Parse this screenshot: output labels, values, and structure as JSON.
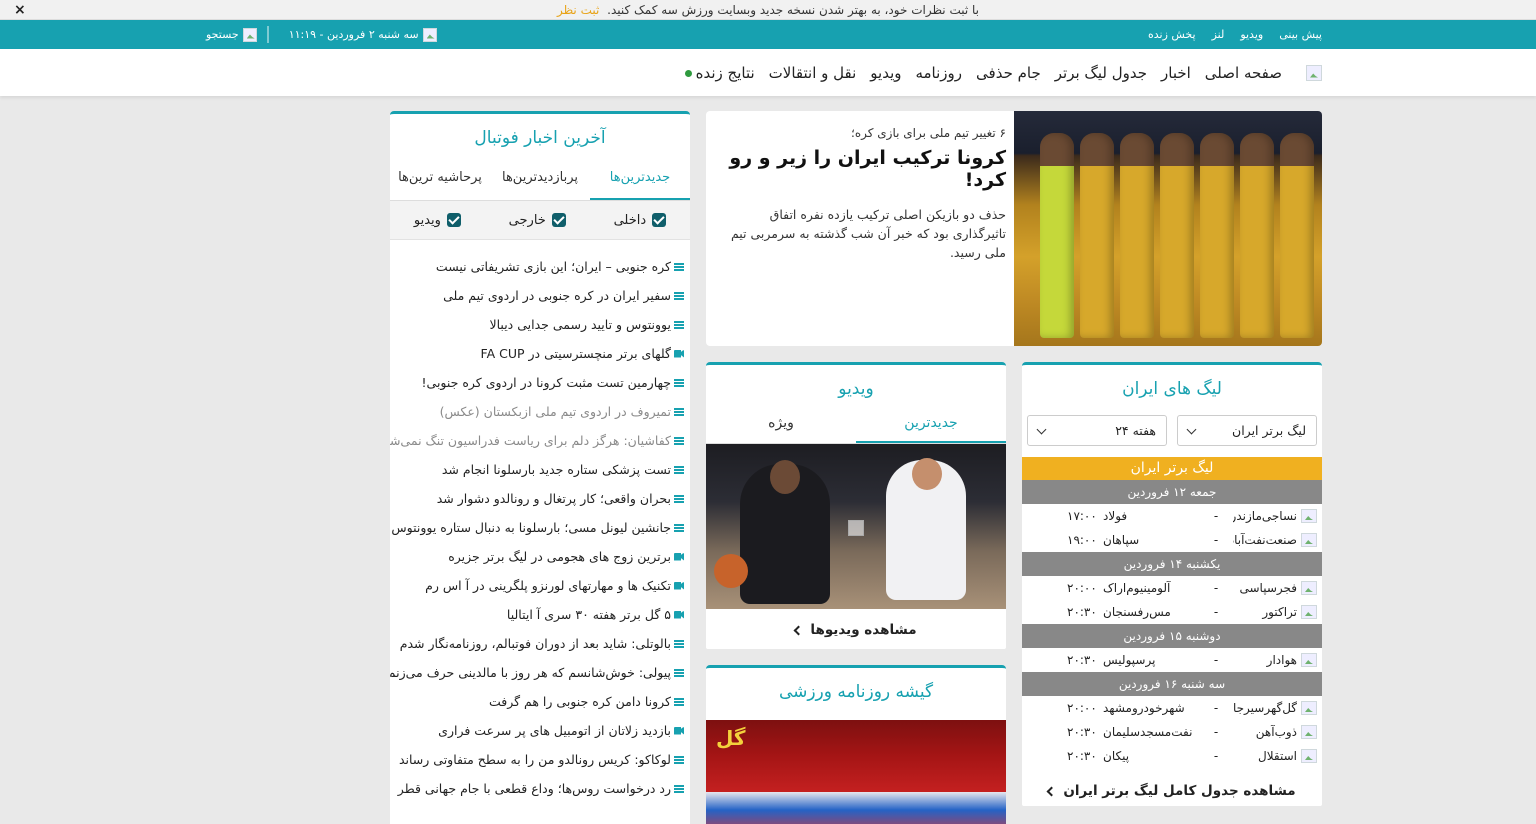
{
  "announce": {
    "text": "با ثبت نظرات خود، به بهتر شدن نسخه جدید وبسایت ورزش سه کمک کنید.",
    "cta": "ثبت نظر",
    "close": "×"
  },
  "topbar": {
    "links": [
      "پیش بینی",
      "ویدیو",
      "لنز",
      "پخش زنده"
    ],
    "date": "سه شنبه ۲ فروردین - ۱۱:۱۹",
    "search": "جستجو"
  },
  "nav": {
    "items": [
      "صفحه اصلی",
      "اخبار",
      "جدول لیگ برتر",
      "جام حذفی",
      "روزنامه",
      "ویدیو",
      "نقل و انتقالات",
      "نتایج زنده"
    ]
  },
  "headline": {
    "kicker": "۶ تغییر تیم ملی برای بازی کره؛",
    "title": "کرونا ترکیب ایران را زیر و رو کرد!",
    "summary": "حذف دو بازیکن اصلی ترکیب یازده نفره اتفاق تاثیرگذاری بود که خبر آن شب گذشته به سرمربی تیم ملی رسید."
  },
  "news": {
    "title": "آخرین اخبار فوتبال",
    "tabs": [
      "جدیدترین‌ها",
      "پربازدیدترین‌ها",
      "پرحاشیه ترین‌ها"
    ],
    "filters": [
      "داخلی",
      "خارجی",
      "ویدیو"
    ],
    "items": [
      {
        "text": "کره جنوبی – ایران؛ این بازی تشریفاتی نیست",
        "icon": "article-icon"
      },
      {
        "text": "سفیر ایران در کره جنوبی در اردوی تیم ملی",
        "icon": "article-icon"
      },
      {
        "text": "یوونتوس و تایید رسمی جدایی دیبالا",
        "icon": "article-icon"
      },
      {
        "text": "گلهای برتر منچسترسیتی در FA CUP",
        "icon": "video-icon"
      },
      {
        "text": "چهارمین تست مثبت کرونا در اردوی کره جنوبی!",
        "icon": "article-icon"
      },
      {
        "text": "تمیروف در اردوی تیم ملی ازبکستان (عکس)",
        "icon": "article-icon",
        "muted": true
      },
      {
        "text": "کفاشیان: هرگز دلم برای ریاست فدراسیون تنگ نمی‌شود",
        "icon": "article-icon",
        "muted": true
      },
      {
        "text": "تست پزشکی ستاره جدید بارسلونا انجام شد",
        "icon": "article-icon"
      },
      {
        "text": "بحران واقعی؛ کار پرتغال و رونالدو دشوار شد",
        "icon": "article-icon"
      },
      {
        "text": "جانشین لیونل مسی؛ بارسلونا به دنبال ستاره یوونتوس",
        "icon": "article-icon"
      },
      {
        "text": "برترین زوج های هجومی در لیگ برتر جزیره",
        "icon": "video-icon"
      },
      {
        "text": "تکنیک ها و مهارتهای لورنزو پلگرینی در آ اس رم",
        "icon": "video-icon"
      },
      {
        "text": "۵ گل برتر هفته ۳۰ سری آ ایتالیا",
        "icon": "video-icon"
      },
      {
        "text": "بالوتلی: شاید بعد از دوران فوتبالم، روزنامه‌نگار شدم",
        "icon": "article-icon"
      },
      {
        "text": "پیولی: خوش‌شانسم که هر روز با مالدینی حرف می‌زنم",
        "icon": "article-icon"
      },
      {
        "text": "کرونا دامن کره جنوبی را هم گرفت",
        "icon": "article-icon"
      },
      {
        "text": "بازدید زلاتان از اتومبیل های پر سرعت فراری",
        "icon": "video-icon"
      },
      {
        "text": "لوکاکو: کریس رونالدو من را به سطح متفاوتی رساند",
        "icon": "article-icon"
      },
      {
        "text": "رد درخواست روس‌ها؛ وداع قطعی با جام جهانی قطر",
        "icon": "article-icon"
      }
    ]
  },
  "league": {
    "title": "لیگ های ایران",
    "select_league": "لیگ برتر ایران",
    "select_week": "هفته ۲۴",
    "league_name": "لیگ برتر ایران",
    "days": [
      {
        "date": "جمعه ۱۲ فروردین",
        "matches": [
          {
            "home": "نساجی‌مازندران",
            "away": "فولاد",
            "time": "۱۷:۰۰"
          },
          {
            "home": "صنعت‌نفت‌آبادان",
            "away": "سپاهان",
            "time": "۱۹:۰۰"
          }
        ]
      },
      {
        "date": "یکشنبه ۱۴ فروردین",
        "matches": [
          {
            "home": "فجرسپاسی",
            "away": "آلومینیوم‌اراک",
            "time": "۲۰:۰۰"
          },
          {
            "home": "تراکتور",
            "away": "مس‌رفسنجان",
            "time": "۲۰:۳۰"
          }
        ]
      },
      {
        "date": "دوشنبه ۱۵ فروردین",
        "matches": [
          {
            "home": "هوادار",
            "away": "پرسپولیس",
            "time": "۲۰:۳۰"
          }
        ]
      },
      {
        "date": "سه شنبه ۱۶ فروردین",
        "matches": [
          {
            "home": "گل‌گهرسیرجان",
            "away": "شهرخودرومشهد",
            "time": "۲۰:۰۰"
          },
          {
            "home": "ذوب‌آهن",
            "away": "نفت‌مسجدسلیمان",
            "time": "۲۰:۳۰"
          },
          {
            "home": "استقلال",
            "away": "پیکان",
            "time": "۲۰:۳۰"
          }
        ]
      }
    ],
    "more": "مشاهده جدول کامل لیگ برتر ایران"
  },
  "video": {
    "title": "ویدیو",
    "tabs": [
      "جدیدترین",
      "ویژه"
    ],
    "more": "مشاهده ویدیوها"
  },
  "papers": {
    "title": "گیشه روزنامه ورزشی",
    "masthead": "گل"
  }
}
